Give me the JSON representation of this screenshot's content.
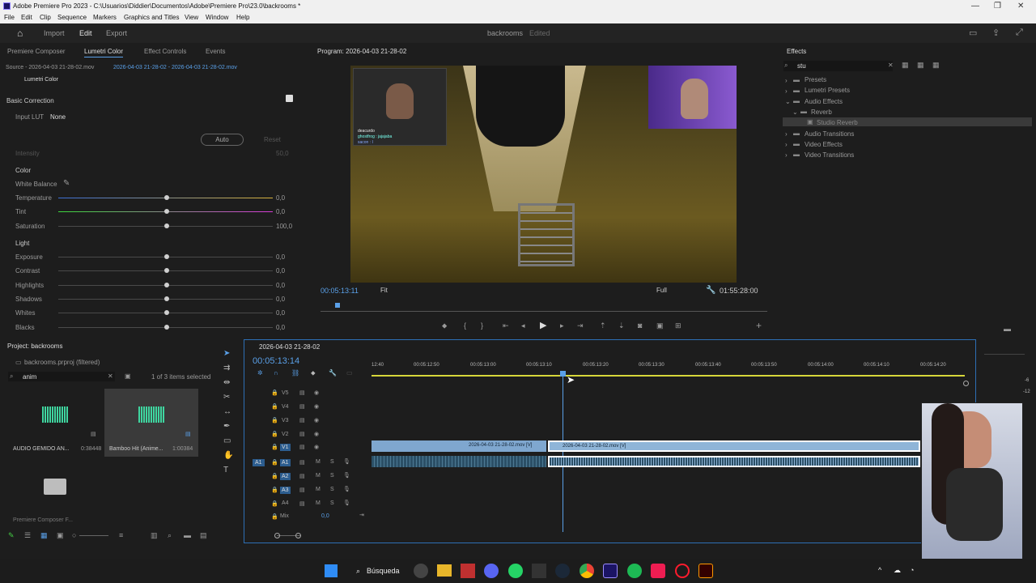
{
  "window": {
    "title": "Adobe Premiere Pro 2023 - C:\\Usuarios\\Diddier\\Documentos\\Adobe\\Premiere Pro\\23.0\\backrooms *"
  },
  "menu": [
    "File",
    "Edit",
    "Clip",
    "Sequence",
    "Markers",
    "Graphics and Titles",
    "View",
    "Window",
    "Help"
  ],
  "header": {
    "import": "Import",
    "edit": "Edit",
    "export": "Export",
    "project": "backrooms",
    "status": "Edited"
  },
  "left_tabs": [
    "Premiere Composer",
    "Lumetri Color",
    "Effect Controls",
    "Events"
  ],
  "source": {
    "label": "Source - 2026-04-03 21-28-02.mov",
    "clip": "2026-04-03 21-28-02 - 2026-04-03 21-28-02.mov",
    "effect": "Lumetri Color"
  },
  "lumetri": {
    "basic": "Basic Correction",
    "input_lut_label": "Input LUT",
    "input_lut": "None",
    "auto": "Auto",
    "reset": "Reset",
    "intensity": "Intensity",
    "intensity_val": "50,0",
    "color": "Color",
    "white_balance": "White Balance",
    "color_rows": [
      {
        "label": "Temperature",
        "value": "0,0"
      },
      {
        "label": "Tint",
        "value": "0,0"
      },
      {
        "label": "Saturation",
        "value": "100,0"
      }
    ],
    "light": "Light",
    "light_rows": [
      {
        "label": "Exposure",
        "value": "0,0"
      },
      {
        "label": "Contrast",
        "value": "0,0"
      },
      {
        "label": "Highlights",
        "value": "0,0"
      },
      {
        "label": "Shadows",
        "value": "0,0"
      },
      {
        "label": "Whites",
        "value": "0,0"
      },
      {
        "label": "Blacks",
        "value": "0,0"
      }
    ]
  },
  "program": {
    "title": "Program: 2026-04-03 21-28-02",
    "timecode": "00:05:13:11",
    "fit": "Fit",
    "quality": "Full",
    "duration": "01:55:28:00"
  },
  "effects": {
    "title": "Effects",
    "search": "stu",
    "tree": [
      {
        "label": "Presets",
        "level": 0
      },
      {
        "label": "Lumetri Presets",
        "level": 0
      },
      {
        "label": "Audio Effects",
        "level": 0
      },
      {
        "label": "Reverb",
        "level": 1
      },
      {
        "label": "Studio Reverb",
        "level": 2
      },
      {
        "label": "Audio Transitions",
        "level": 0
      },
      {
        "label": "Video Effects",
        "level": 0
      },
      {
        "label": "Video Transitions",
        "level": 0
      }
    ]
  },
  "project": {
    "title": "Project: backrooms",
    "file": "backrooms.prproj (filtered)",
    "search": "anim",
    "count": "1 of 3 items selected",
    "items": [
      {
        "name": "AUDIO GEMIDO AN...",
        "dur": "0:38448"
      },
      {
        "name": "Bamboo Hit (Anime...",
        "dur": "1:00384"
      },
      {
        "name": "Premiere Composer F...",
        "dur": ""
      }
    ]
  },
  "timeline": {
    "title": "2026-04-03 21-28-02",
    "timecode": "00:05:13:14",
    "ruler": [
      "12:40",
      "00:05:12:50",
      "00:05:13:00",
      "00:05:13:10",
      "00:05:13:20",
      "00:05:13:30",
      "00:05:13:40",
      "00:05:13:50",
      "00:05:14:00",
      "00:05:14:10",
      "00:05:14:20"
    ],
    "video_tracks": [
      "V5",
      "V4",
      "V3",
      "V2",
      "V1"
    ],
    "audio_tracks": [
      "A1",
      "A2",
      "A3",
      "A4"
    ],
    "mix": "Mix",
    "mix_val": "0,0",
    "clip1": "2026-04-03 21-28-02.mov [V]",
    "clip2": "2026-04-03 21-28-02.mov [V]"
  },
  "meter": [
    "-6",
    "-12"
  ],
  "overlay": {
    "chat1": "deacurdo",
    "chat2": "ghostfrog : jajajaba",
    "chat3": "sacon : I"
  },
  "taskbar": {
    "search": "Búsqueda"
  }
}
